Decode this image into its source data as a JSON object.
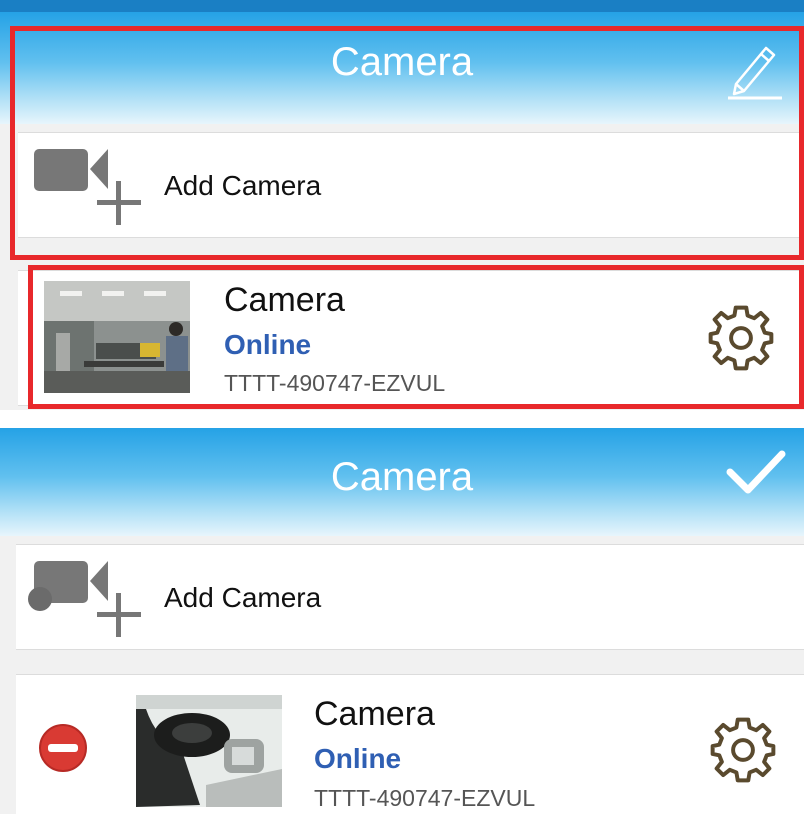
{
  "top": {
    "header": {
      "title": "Camera",
      "action_icon": "pencil-icon"
    },
    "add_camera": {
      "label": "Add Camera",
      "icon": "video-camera-plus-icon"
    },
    "camera": {
      "name": "Camera",
      "status": "Online",
      "id": "TTTT-490747-EZVUL",
      "settings_icon": "gear-icon"
    },
    "highlight_color": "#e8282b"
  },
  "bottom": {
    "header": {
      "title": "Camera",
      "action_icon": "check-icon"
    },
    "add_camera": {
      "label": "Add Camera",
      "icon": "video-camera-plus-icon"
    },
    "camera": {
      "name": "Camera",
      "status": "Online",
      "id": "TTTT-490747-EZVUL",
      "delete_icon": "minus-circle-icon",
      "settings_icon": "gear-icon"
    }
  },
  "colors": {
    "header_blue": "#25a2e6",
    "status_blue": "#2f5fb3",
    "delete_red": "#d93a33",
    "gear_brown": "#5a4a2e",
    "icon_gray": "#777777"
  }
}
